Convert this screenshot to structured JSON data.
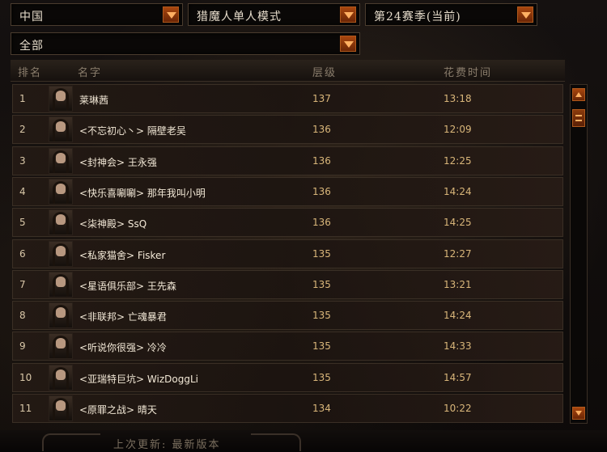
{
  "filters": {
    "region": "中国",
    "mode": "猎魔人单人模式",
    "season": "第24赛季(当前)",
    "category": "全部"
  },
  "table": {
    "headers": {
      "rank": "排名",
      "name": "名字",
      "level": "层级",
      "time": "花费时间"
    },
    "rows": [
      {
        "rank": "1",
        "name": "莱琳茜",
        "level": "137",
        "time": "13:18"
      },
      {
        "rank": "2",
        "name": "<不忘初心丶> 隔壁老吴",
        "level": "136",
        "time": "12:09"
      },
      {
        "rank": "3",
        "name": "<封神会> 王永强",
        "level": "136",
        "time": "12:25"
      },
      {
        "rank": "4",
        "name": "<快乐喜唰唰> 那年我叫小明",
        "level": "136",
        "time": "14:24"
      },
      {
        "rank": "5",
        "name": "<柒神殿> SsQ",
        "level": "136",
        "time": "14:25"
      },
      {
        "rank": "6",
        "name": "<私家猫舍> Fisker",
        "level": "135",
        "time": "12:27"
      },
      {
        "rank": "7",
        "name": "<星语俱乐部> 王先森",
        "level": "135",
        "time": "13:21"
      },
      {
        "rank": "8",
        "name": "<非联邦> 亡魂暴君",
        "level": "135",
        "time": "14:24"
      },
      {
        "rank": "9",
        "name": "<听说你很强> 冷冷",
        "level": "135",
        "time": "14:33"
      },
      {
        "rank": "10",
        "name": "<亚瑞特巨坑> WizDoggLi",
        "level": "135",
        "time": "14:57"
      },
      {
        "rank": "11",
        "name": "<原罪之战> 晴天",
        "level": "134",
        "time": "10:22"
      }
    ]
  },
  "footer": {
    "last_update": "上次更新: 最新版本"
  },
  "icons": {
    "dropdown_arrow": "chevron-down-icon",
    "scroll_up": "arrow-up-icon",
    "scroll_down": "arrow-down-icon",
    "portrait": "demon-hunter-portrait"
  },
  "colors": {
    "accent": "#a8460e",
    "level_text": "#d9b67a",
    "name_text": "#f2e8d6"
  }
}
